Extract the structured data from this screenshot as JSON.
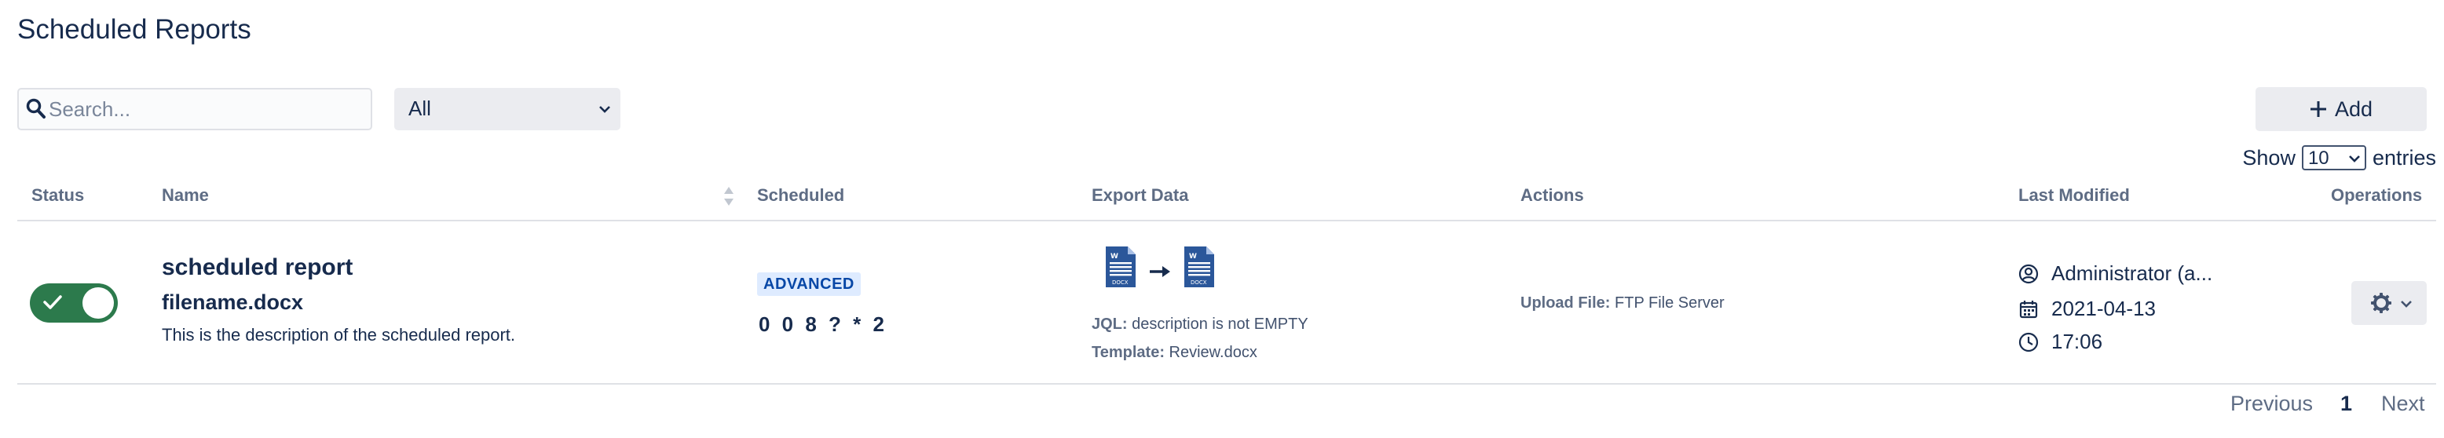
{
  "page": {
    "title": "Scheduled Reports"
  },
  "toolbar": {
    "search_placeholder": "Search...",
    "search_value": "",
    "filter_value": "All",
    "add_label": "Add"
  },
  "entries": {
    "show_label": "Show",
    "value": "10",
    "entries_label": "entries"
  },
  "table": {
    "columns": {
      "status": "Status",
      "name": "Name",
      "scheduled": "Scheduled",
      "export_data": "Export Data",
      "actions": "Actions",
      "last_modified": "Last Modified",
      "operations": "Operations"
    },
    "rows": [
      {
        "status_enabled": true,
        "name": "scheduled report",
        "file": "filename.docx",
        "description": "This is the description of the scheduled report.",
        "schedule_badge": "ADVANCED",
        "cron": "0 0 8 ? * 2",
        "source_icon": "word-docx-icon",
        "target_icon": "word-docx-icon",
        "jql_label": "JQL:",
        "jql_value": "description is not EMPTY",
        "template_label": "Template:",
        "template_value": "Review.docx",
        "action_label": "Upload File:",
        "action_value": "FTP File Server",
        "modified_by": "Administrator (a...",
        "modified_date": "2021-04-13",
        "modified_time": "17:06"
      }
    ]
  },
  "pagination": {
    "previous": "Previous",
    "current": "1",
    "next": "Next"
  },
  "colors": {
    "toggle_on": "#2c7a4c",
    "badge_bg": "#deebff",
    "badge_text": "#0747a6",
    "text": "#172b4d",
    "muted": "#5e6c84",
    "docx_blue": "#2b579a"
  }
}
